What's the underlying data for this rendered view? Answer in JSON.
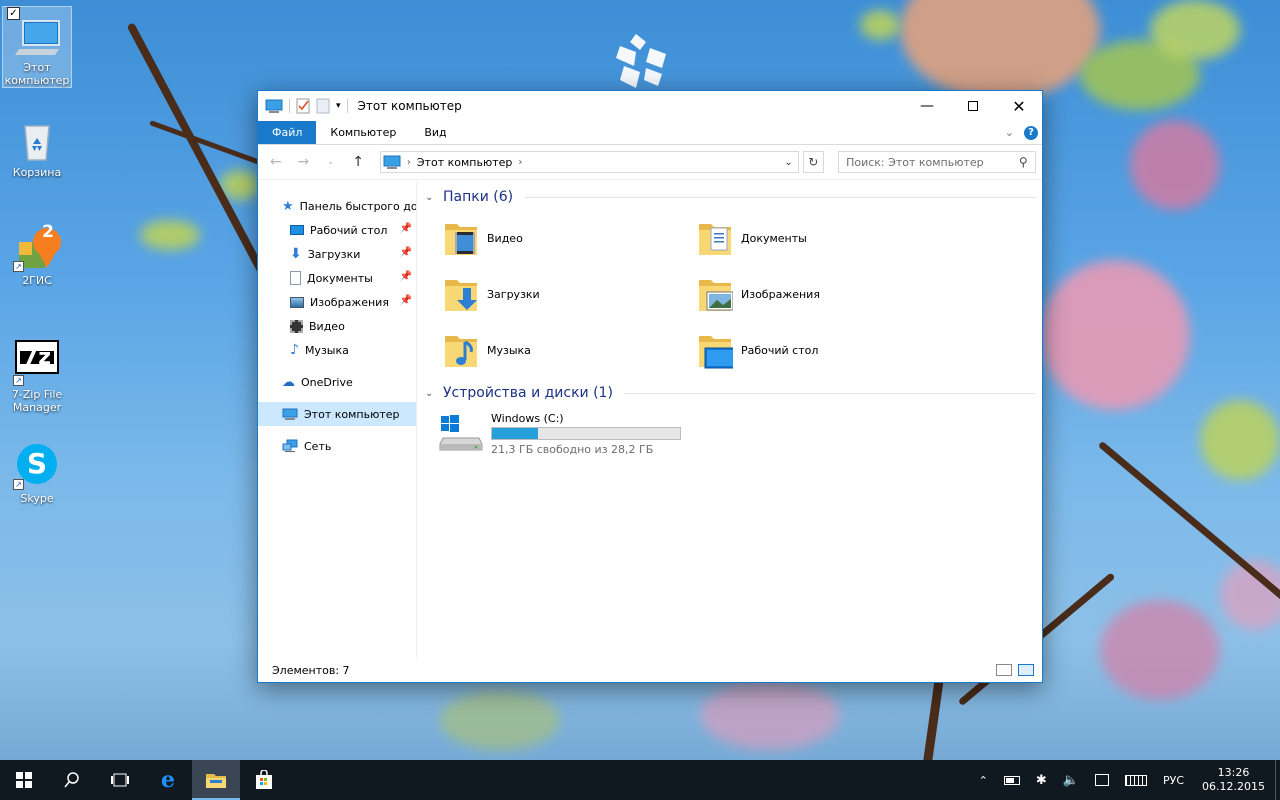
{
  "desktop": {
    "icons": [
      {
        "label_line1": "Этот",
        "label_line2": "компьютер",
        "icon": "this-pc-icon"
      },
      {
        "label": "Корзина",
        "icon": "recycle-bin-icon"
      },
      {
        "label": "2ГИС",
        "icon": "2gis-icon",
        "badge": "2"
      },
      {
        "label_line1": "7-Zip File",
        "label_line2": "Manager",
        "icon": "7zip-icon",
        "logo": "7z"
      },
      {
        "label": "Skype",
        "icon": "skype-icon",
        "logo": "S"
      }
    ]
  },
  "window": {
    "title": "Этот компьютер",
    "ribbon": {
      "tabs": [
        "Файл",
        "Компьютер",
        "Вид"
      ],
      "help": "?"
    },
    "address": {
      "path": "Этот компьютер",
      "search_placeholder": "Поиск: Этот компьютер"
    },
    "navpane": {
      "quick_access": "Панель быстрого доступа",
      "items": [
        {
          "label": "Рабочий стол",
          "pinned": true
        },
        {
          "label": "Загрузки",
          "pinned": true
        },
        {
          "label": "Документы",
          "pinned": true
        },
        {
          "label": "Изображения",
          "pinned": true
        },
        {
          "label": "Видео",
          "pinned": false
        },
        {
          "label": "Музыка",
          "pinned": false
        }
      ],
      "onedrive": "OneDrive",
      "this_pc": "Этот компьютер",
      "network": "Сеть"
    },
    "folders_group": {
      "heading": "Папки (6)",
      "items": [
        "Видео",
        "Документы",
        "Загрузки",
        "Изображения",
        "Музыка",
        "Рабочий стол"
      ]
    },
    "devices_group": {
      "heading": "Устройства и диски (1)",
      "drive": {
        "name": "Windows (C:)",
        "free_text": "21,3 ГБ свободно из 28,2 ГБ",
        "used_fraction": 0.245
      }
    },
    "status": {
      "items_count": "Элементов: 7"
    }
  },
  "taskbar": {
    "language": "РУС",
    "time": "13:26",
    "date": "06.12.2015"
  },
  "colors": {
    "accent": "#1979ca",
    "selection": "#cce8ff",
    "group_heading": "#1e3287",
    "drive_fill": "#26a0da",
    "taskbar": "#101820"
  }
}
